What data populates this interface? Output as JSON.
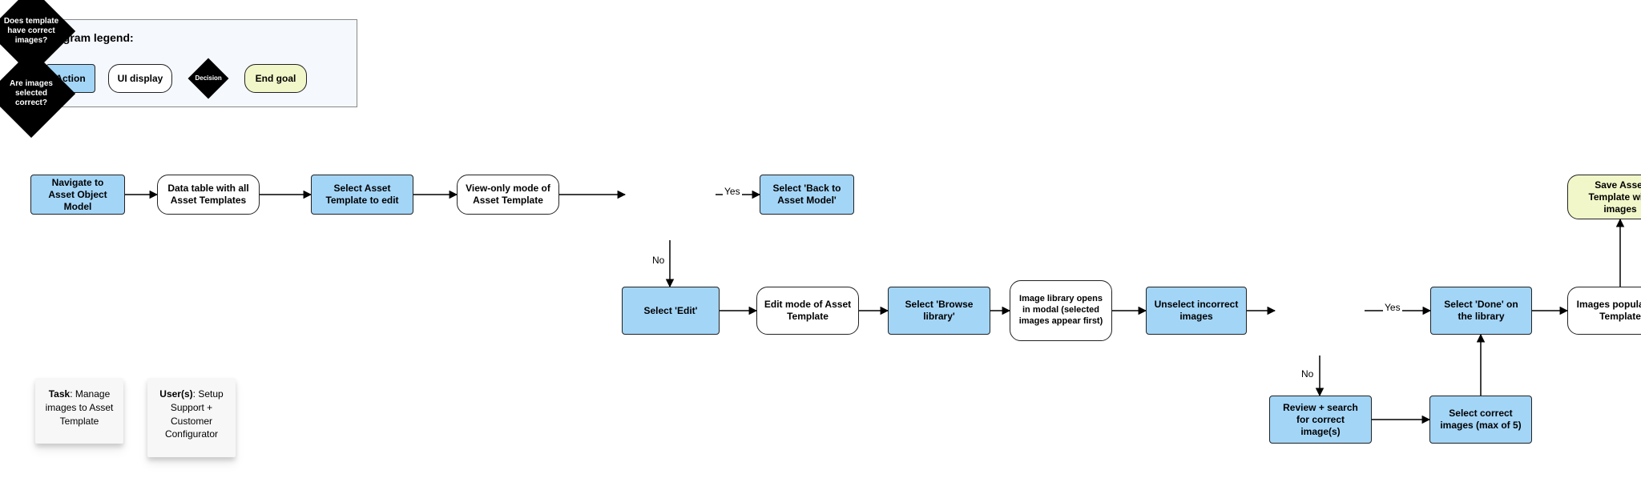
{
  "legend": {
    "title": "Diagram legend:",
    "action": "Action",
    "display": "UI display",
    "decision": "Decision",
    "goal": "End goal"
  },
  "nodes": {
    "n1": "Navigate to Asset Object Model",
    "n2": "Data table with all Asset Templates",
    "n3": "Select Asset Template to edit",
    "n4": "View-only mode of Asset Template",
    "d1": "Does template have correct images?",
    "n5": "Select 'Back to Asset Model'",
    "n6": "Select 'Edit'",
    "n7": "Edit mode of Asset Template",
    "n8": "Select 'Browse library'",
    "n9": "Image library opens in modal (selected images appear first)",
    "n10": "Unselect incorrect images",
    "d2": "Are images selected correct?",
    "n11": "Select 'Done' on the library",
    "n12": "Images populate in Template",
    "n13": "Review + search for correct image(s)",
    "n14": "Select correct images (max of 5)",
    "g1": "Save Asset Template with images"
  },
  "edges": {
    "yes": "Yes",
    "no": "No"
  },
  "stickies": {
    "task_label": "Task",
    "task_value": ": Manage images to Asset Template",
    "users_label": "User(s)",
    "users_value": ": Setup Support + Customer Configurator"
  }
}
